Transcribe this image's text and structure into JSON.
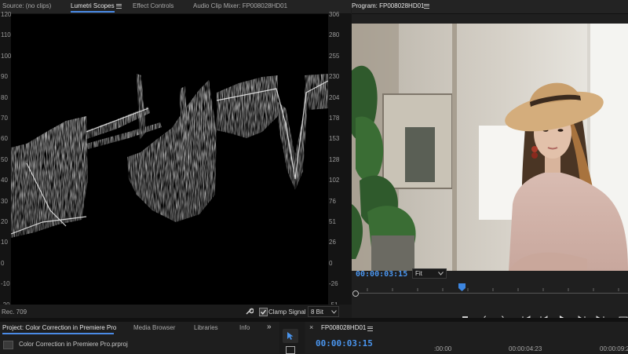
{
  "top_left_tabs": {
    "source": "Source: (no clips)",
    "lumetri": "Lumetri Scopes",
    "effect_controls": "Effect Controls",
    "audio_mixer": "Audio Clip Mixer: FP008028HD01"
  },
  "scope": {
    "left_ticks": [
      "120",
      "110",
      "100",
      "90",
      "80",
      "70",
      "60",
      "50",
      "40",
      "30",
      "20",
      "10",
      "0",
      "-10",
      "-20"
    ],
    "right_ticks": [
      "306",
      "280",
      "255",
      "230",
      "204",
      "178",
      "153",
      "128",
      "102",
      "76",
      "51",
      "26",
      "0",
      "-26",
      "-51"
    ],
    "footer_left": "Rec. 709",
    "clamp_label": "Clamp Signal",
    "bit_depth": "8 Bit"
  },
  "program": {
    "title": "Program: FP008028HD01",
    "timecode": "00:00:03:15",
    "fit": "Fit"
  },
  "project": {
    "tab_project": "Project: Color Correction in Premiere Pro",
    "tab_media": "Media Browser",
    "tab_libraries": "Libraries",
    "tab_info": "Info",
    "more": "»",
    "file_name": "Color Correction in Premiere Pro.prproj"
  },
  "timeline": {
    "close": "×",
    "sequence": "FP008028HD01",
    "timecode": "00:00:03:15",
    "ruler": [
      ":00:00",
      "00:00:04:23",
      "00:00:09:2"
    ]
  },
  "colors": {
    "accent": "#4a95ee",
    "playhead": "#3d86e0"
  }
}
